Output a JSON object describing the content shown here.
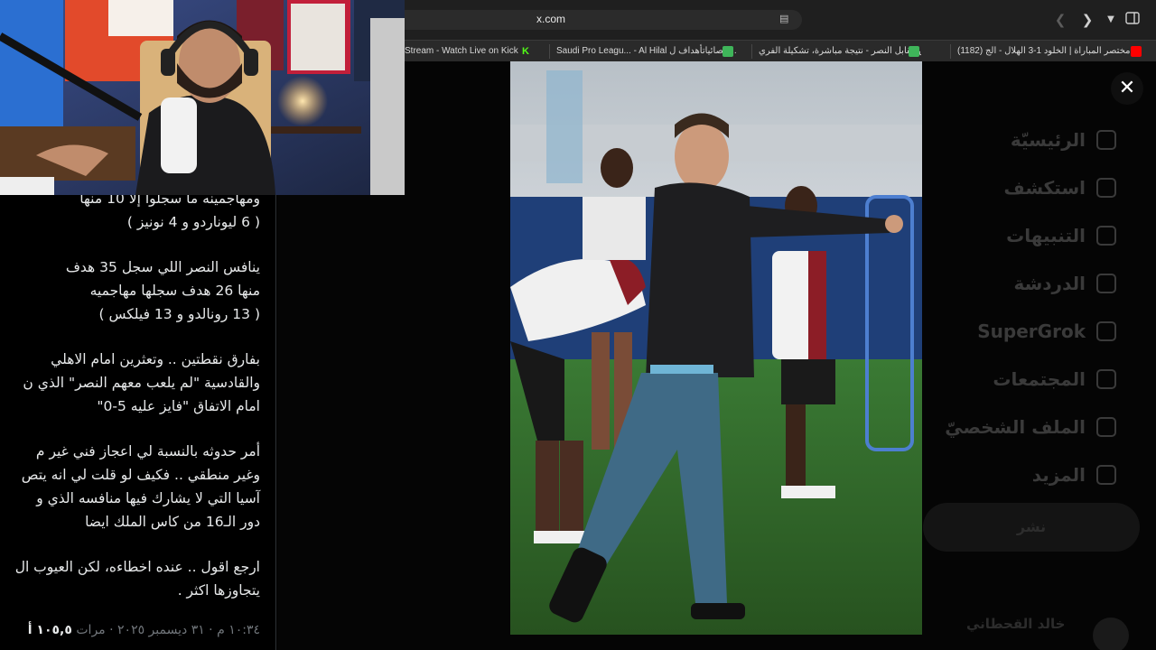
{
  "browser": {
    "url": "x.com",
    "tabs": [
      {
        "label": "(1182) مختصر المباراة | الخلود 1-3 الهلال - الج...",
        "favicon_color": "#ff0000"
      },
      {
        "label": "الاتفاق مقابل النصر - نتيجة مباشرة، تشكيلة الفري...",
        "favicon_color": "#3fb55a"
      },
      {
        "label": "Saudi Pro Leagu... - Al Hilal إحصائياتأهداف ل...",
        "favicon_color": "#3fb55a"
      },
      {
        "label": "Stream - Watch Live on Kick",
        "favicon_color": "#53fc18"
      }
    ]
  },
  "tweet": {
    "lines": [
      {
        "text": "ومهاجمينه ما سجلوا إلا 10 منها"
      },
      {
        "text": "( 6 ليوناردو و 4 نونيز )"
      },
      {
        "text": "ينافس النصر اللي سجل 35 هدف"
      },
      {
        "text": "منها 26 هدف سجلها مهاجميه"
      },
      {
        "text": "( 13 رونالدو و 13 فيلكس )"
      },
      {
        "text": "بفارق نقطتين .. وتعثرين امام الاهلي"
      },
      {
        "text": "والقادسية \"لم يلعب معهم النصر\" الذي ن"
      },
      {
        "text": "امام الاتفاق \"فايز عليه 5-0\""
      },
      {
        "text": "أمر حدوثه بالنسبة لي اعجاز فني غير م"
      },
      {
        "text": "وغير منطقي .. فكيف لو قلت لي انه يتص"
      },
      {
        "text": "آسيا التي لا يشارك فيها منافسه الذي و"
      },
      {
        "text": "دور الـ16 من كاس الملك ايضا"
      },
      {
        "text": "ارجع اقول .. عنده اخطاءه، لكن العيوب ال"
      },
      {
        "text": "يتجاوزها اكثر ."
      }
    ],
    "timestamp": "١٠:٣٤ م · ٣١ ديسمبر ٢٠٢٥ ·",
    "views_label": "مرات",
    "views_count": "١٠٥,٥ أ"
  },
  "sidebar": {
    "items": [
      {
        "label": "الرئيسيّة",
        "icon": "home-icon"
      },
      {
        "label": "استكشف",
        "icon": "search-icon"
      },
      {
        "label": "التنبيهات",
        "icon": "bell-icon"
      },
      {
        "label": "الدردشة",
        "icon": "mail-icon"
      },
      {
        "label": "SuperGrok",
        "icon": "grok-icon"
      },
      {
        "label": "المجتمعات",
        "icon": "communities-icon"
      },
      {
        "label": "الملف الشخصيّ",
        "icon": "profile-icon"
      },
      {
        "label": "المزيد",
        "icon": "more-icon"
      }
    ],
    "post_button": "نشر",
    "profile_name": "خالد القحطاني"
  },
  "modal": {
    "close_label": "✕"
  }
}
